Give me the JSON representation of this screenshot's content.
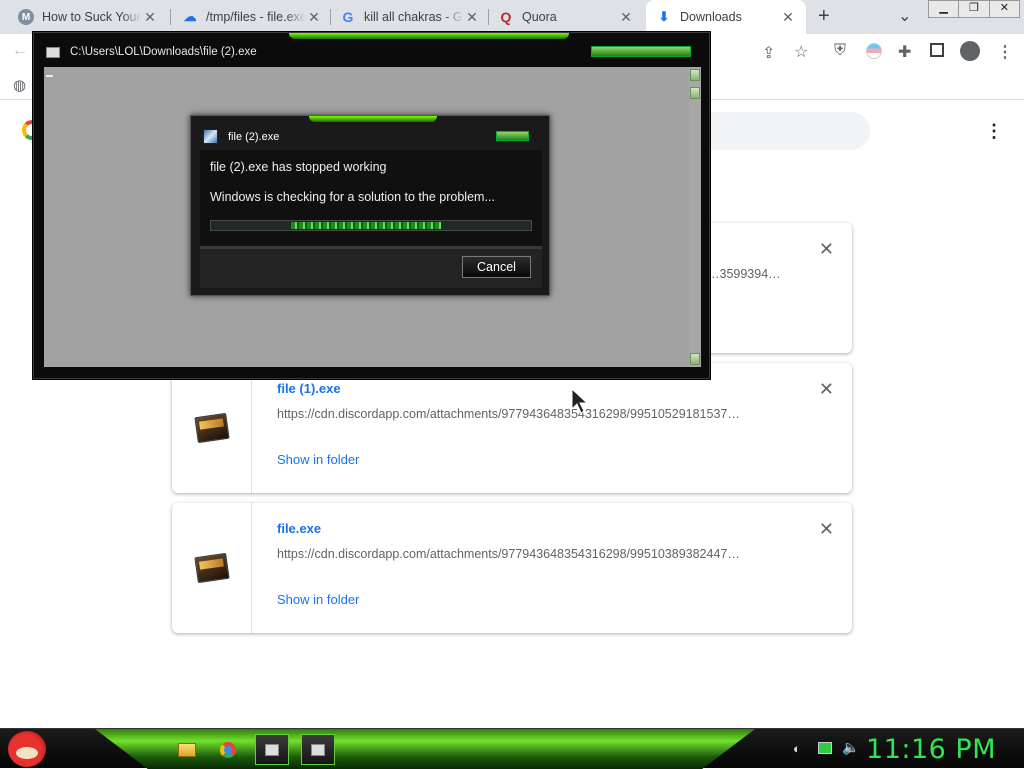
{
  "browser": {
    "tabs": [
      {
        "title": "How to Suck Your",
        "favicon": "M",
        "favicon_color": "#7f8ea3"
      },
      {
        "title": "/tmp/files - file.exe",
        "favicon": "☁",
        "favicon_color": "#1a73e8"
      },
      {
        "title": "kill all chakras - G",
        "favicon": "G",
        "favicon_color": "#4285f4"
      },
      {
        "title": "Quora",
        "favicon": "Q",
        "favicon_color": "#b92b27"
      },
      {
        "title": "Downloads",
        "favicon": "⬇",
        "favicon_color": "#1a73e8"
      }
    ],
    "new_tab_label": "+",
    "tab_list_label": "⌄"
  },
  "console": {
    "title": "C:\\Users\\LOL\\Downloads\\file (2).exe"
  },
  "dialog": {
    "title": "file (2).exe",
    "message": "file (2).exe has stopped working",
    "status": "Windows is checking for a solution to the problem...",
    "cancel_label": "Cancel"
  },
  "downloads": [
    {
      "name": "",
      "url": "…3599394…",
      "show_label": "",
      "partial": true
    },
    {
      "name": "file (1).exe",
      "url": "https://cdn.discordapp.com/attachments/977943648354316298/99510529181537…",
      "show_label": "Show in folder"
    },
    {
      "name": "file.exe",
      "url": "https://cdn.discordapp.com/attachments/977943648354316298/99510389382447…",
      "show_label": "Show in folder"
    }
  ],
  "taskbar": {
    "clock": "11:16 PM"
  },
  "colors": {
    "accent_green": "#32e650",
    "link_blue": "#1a73e8"
  }
}
